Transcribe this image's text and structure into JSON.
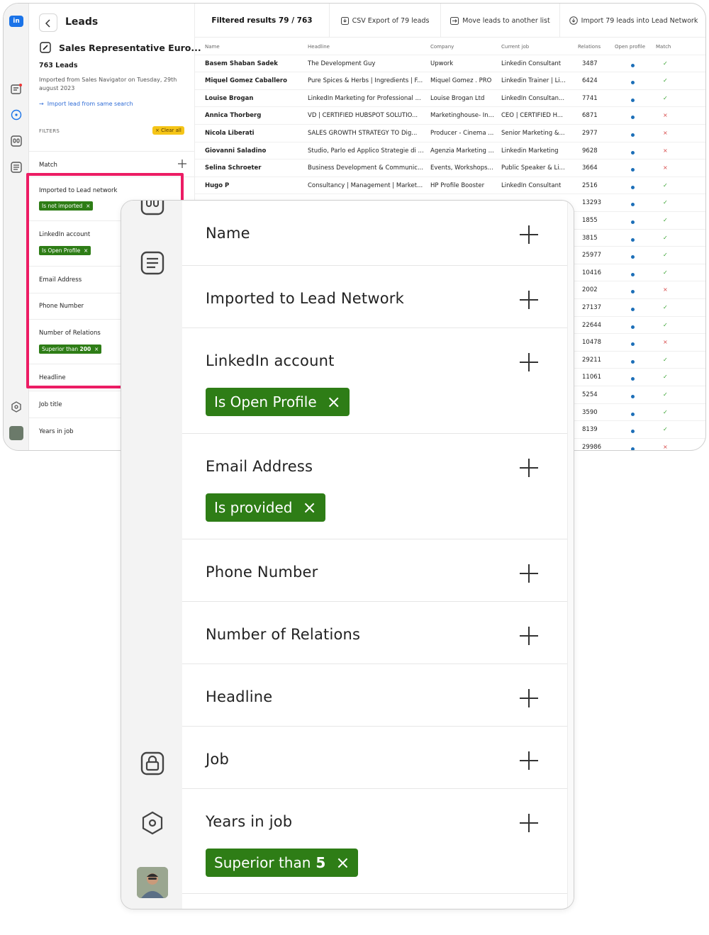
{
  "app": {
    "page_title": "Leads",
    "list_name": "Sales Representative Euro...",
    "lead_count": "763 Leads",
    "imported_from": "Imported from Sales Navigator on Tuesday, 29th august 2023",
    "import_link": "Import lead from same search",
    "filters_label": "FILTERS",
    "clear_all": "Clear all",
    "filters": [
      {
        "label": "Match"
      },
      {
        "label": "Imported to Lead network",
        "chip": "Is not imported"
      },
      {
        "label": "LinkedIn account",
        "chip": "Is Open Profile"
      },
      {
        "label": "Email Address"
      },
      {
        "label": "Phone Number"
      },
      {
        "label": "Number of Relations",
        "chip_prefix": "Superior than",
        "chip_value": "200"
      },
      {
        "label": "Headline"
      },
      {
        "label": "Job title"
      },
      {
        "label": "Years in job"
      }
    ]
  },
  "toolbar": {
    "filtered": "Filtered results 79 / 763",
    "csv": "CSV Export of 79 leads",
    "move": "Move leads to another list",
    "import": "Import 79 leads into Lead Network"
  },
  "table": {
    "headers": [
      "Name",
      "Headline",
      "Company",
      "Current job",
      "Relations",
      "Open profile",
      "Match"
    ],
    "rows": [
      {
        "name": "Basem Shaban Sadek",
        "headline": "The Development Guy",
        "company": "Upwork",
        "job": "Linkedin Consultant",
        "relations": "3487",
        "match": "yes"
      },
      {
        "name": "Miquel Gomez Caballero",
        "headline": "Pure Spices & Herbs | Ingredients | F...",
        "company": "Miquel Gomez . PRO",
        "job": "Linkedin Trainer | Li...",
        "relations": "6424",
        "match": "yes"
      },
      {
        "name": "Louise Brogan",
        "headline": "LinkedIn Marketing for Professional ...",
        "company": "Louise Brogan Ltd",
        "job": "LinkedIn Consultan...",
        "relations": "7741",
        "match": "yes"
      },
      {
        "name": "Annica Thorberg",
        "headline": "VD | CERTIFIED HUBSPOT SOLUTIO...",
        "company": "Marketinghouse- In...",
        "job": "CEO | CERTIFIED H...",
        "relations": "6871",
        "match": "no"
      },
      {
        "name": "Nicola Liberati",
        "headline": "SALES GROWTH STRATEGY TO Dig...",
        "company": "Producer - Cinema ...",
        "job": "Senior Marketing &...",
        "relations": "2977",
        "match": "no"
      },
      {
        "name": "Giovanni Saladino",
        "headline": "Studio, Parlo ed Applico Strategie di ...",
        "company": "Agenzia Marketing ...",
        "job": "Linkedin Marketing",
        "relations": "9628",
        "match": "no"
      },
      {
        "name": "Selina Schroeter",
        "headline": "Business Development & Communic...",
        "company": "Events, Workshops...",
        "job": "Public Speaker & Li...",
        "relations": "3664",
        "match": "no"
      },
      {
        "name": "Hugo P",
        "headline": "Consultancy | Management | Market...",
        "company": "HP Profile Booster",
        "job": "LinkedIn Consultant",
        "relations": "2516",
        "match": "yes"
      },
      {
        "name": "",
        "headline": "",
        "company": "",
        "job": "",
        "relations": "13293",
        "match": "yes"
      },
      {
        "name": "",
        "headline": "",
        "company": "",
        "job": "",
        "relations": "1855",
        "match": "yes"
      },
      {
        "name": "",
        "headline": "",
        "company": "",
        "job": "",
        "relations": "3815",
        "match": "yes"
      },
      {
        "name": "",
        "headline": "",
        "company": "",
        "job": "",
        "relations": "25977",
        "match": "yes"
      },
      {
        "name": "",
        "headline": "",
        "company": "",
        "job": "",
        "relations": "10416",
        "match": "yes"
      },
      {
        "name": "",
        "headline": "",
        "company": "",
        "job": "",
        "relations": "2002",
        "match": "no"
      },
      {
        "name": "",
        "headline": "",
        "company": "",
        "job": "",
        "relations": "27137",
        "match": "yes"
      },
      {
        "name": "",
        "headline": "",
        "company": "",
        "job": "",
        "relations": "22644",
        "match": "yes"
      },
      {
        "name": "",
        "headline": "",
        "company": "",
        "job": "",
        "relations": "10478",
        "match": "no"
      },
      {
        "name": "",
        "headline": "",
        "company": "",
        "job": "",
        "relations": "29211",
        "match": "yes"
      },
      {
        "name": "",
        "headline": "",
        "company": "",
        "job": "",
        "relations": "11061",
        "match": "yes"
      },
      {
        "name": "",
        "headline": "",
        "company": "",
        "job": "",
        "relations": "5254",
        "match": "yes"
      },
      {
        "name": "",
        "headline": "",
        "company": "",
        "job": "",
        "relations": "3590",
        "match": "yes"
      },
      {
        "name": "",
        "headline": "",
        "company": "",
        "job": "",
        "relations": "8139",
        "match": "yes"
      },
      {
        "name": "",
        "headline": "",
        "company": "",
        "job": "",
        "relations": "29986",
        "match": "no"
      }
    ]
  },
  "zoom": {
    "rows": [
      {
        "label": "Name"
      },
      {
        "label": "Imported to Lead Network"
      },
      {
        "label": "LinkedIn account",
        "chip": "Is Open Profile"
      },
      {
        "label": "Email Address",
        "chip": "Is provided"
      },
      {
        "label": "Phone Number"
      },
      {
        "label": "Number of Relations"
      },
      {
        "label": "Headline"
      },
      {
        "label": "Job"
      },
      {
        "label": "Years in job",
        "chip_prefix": "Superior than",
        "chip_value": "5"
      }
    ]
  },
  "icons": {
    "close": "×",
    "check": "✓",
    "cross": "×",
    "arrow": "→"
  },
  "colors": {
    "chip_green": "#2e7d16",
    "highlight_pink": "#ec1c64",
    "clear_yellow": "#f5c518",
    "link_blue": "#2d6bd6"
  }
}
